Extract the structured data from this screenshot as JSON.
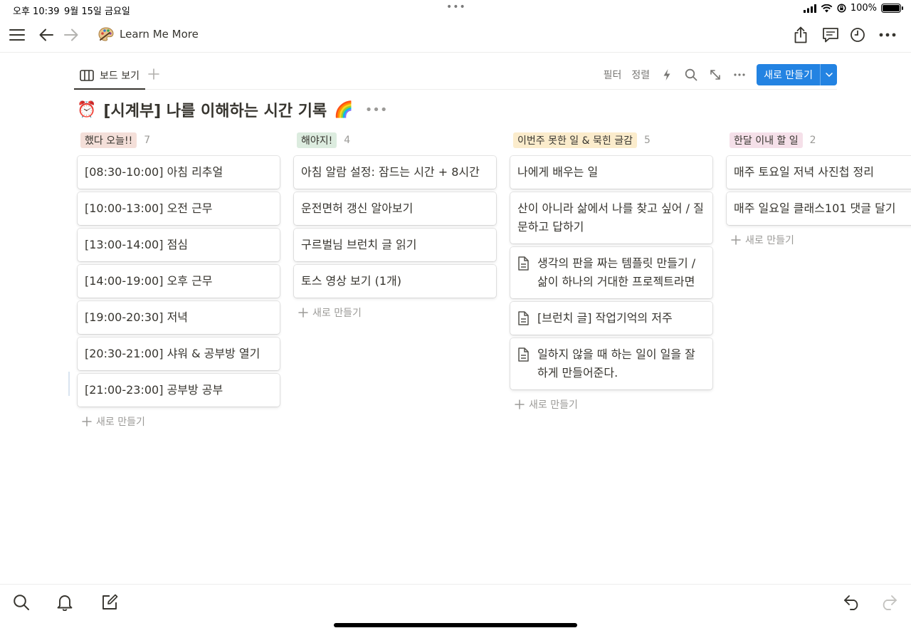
{
  "status": {
    "time": "오후 10:39",
    "date": "9월 15일 금요일",
    "battery": "100%"
  },
  "topnav": {
    "title": "Learn Me More",
    "icons": [
      "menu-icon",
      "back-arrow-icon",
      "forward-arrow-icon",
      "share-icon",
      "comment-icon",
      "clock-icon",
      "more-icon"
    ]
  },
  "viewbar": {
    "tab_label": "보드 보기",
    "filter": "필터",
    "sort": "정렬",
    "new_button": "새로 만들기"
  },
  "page": {
    "title": "[시계부] 나를 이해하는 시간 기록",
    "title_prefix_emoji": "⏰",
    "title_suffix_emoji": "🌈"
  },
  "columns": [
    {
      "label": "했다 오늘!!",
      "count": "7",
      "color": "#f4dfd9",
      "cards": [
        {
          "text": "[08:30-10:00] 아침 리추얼",
          "doc": false
        },
        {
          "text": "[10:00-13:00] 오전 근무",
          "doc": false
        },
        {
          "text": "[13:00-14:00] 점심",
          "doc": false
        },
        {
          "text": "[14:00-19:00] 오후 근무",
          "doc": false
        },
        {
          "text": "[19:00-20:30] 저녁",
          "doc": false
        },
        {
          "text": "[20:30-21:00] 샤워 & 공부방 열기",
          "doc": false
        },
        {
          "text": "[21:00-23:00] 공부방 공부",
          "doc": false
        }
      ],
      "add_label": "새로 만들기"
    },
    {
      "label": "해야지!",
      "count": "4",
      "color": "#dcecdf",
      "cards": [
        {
          "text": "아침 알람 설정: 잠드는 시간 + 8시간",
          "doc": false
        },
        {
          "text": "운전면허 갱신 알아보기",
          "doc": false
        },
        {
          "text": "구르벌님 브런치 글 읽기",
          "doc": false
        },
        {
          "text": "토스 영상 보기 (1개)",
          "doc": false
        }
      ],
      "add_label": "새로 만들기"
    },
    {
      "label": "이번주 못한 일 & 묵힌 글감",
      "count": "5",
      "color": "#fbeccc",
      "cards": [
        {
          "text": "나에게 배우는 일",
          "doc": false
        },
        {
          "text": "산이 아니라 삶에서 나를 찾고 싶어 / 질문하고 답하기",
          "doc": false
        },
        {
          "text": "생각의 판을 짜는 템플릿 만들기 / 삶이 하나의 거대한 프로젝트라면",
          "doc": true
        },
        {
          "text": "[브런치 글] 작업기억의 저주",
          "doc": true
        },
        {
          "text": "일하지 않을 때 하는 일이 일을 잘하게 만들어준다.",
          "doc": true
        }
      ],
      "add_label": "새로 만들기"
    },
    {
      "label": "한달 이내 할 일",
      "count": "2",
      "color": "#f5e0e9",
      "cards": [
        {
          "text": "매주 토요일 저녁 사진첩 정리",
          "doc": false
        },
        {
          "text": "매주 일요일 클래스101 댓글 달기",
          "doc": false
        }
      ],
      "add_label": "새로 만들기"
    }
  ],
  "colors": {
    "accent": "#2383e2",
    "text": "#37352f",
    "muted": "#9b9a97"
  }
}
